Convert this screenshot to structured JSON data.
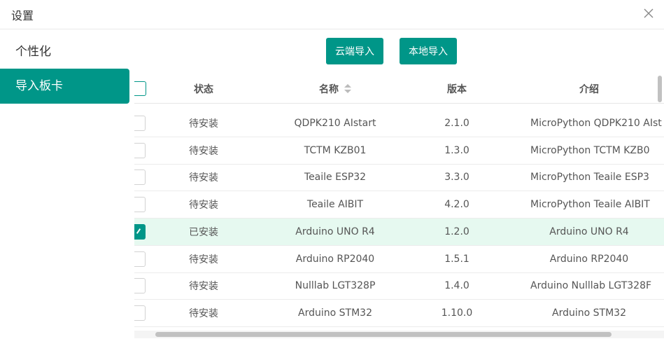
{
  "window": {
    "title": "设置"
  },
  "sidebar": {
    "items": [
      {
        "label": "个性化"
      },
      {
        "label": "导入板卡"
      }
    ]
  },
  "toolbar": {
    "cloud_import": "云端导入",
    "local_import": "本地导入"
  },
  "table": {
    "columns": {
      "status": "状态",
      "name": "名称",
      "version": "版本",
      "intro": "介绍"
    },
    "rows": [
      {
        "checked": false,
        "status": "待安装",
        "name": "QDPK210 AIstart",
        "version": "2.1.0",
        "intro": "MicroPython QDPK210 AIst"
      },
      {
        "checked": false,
        "status": "待安装",
        "name": "TCTM KZB01",
        "version": "1.3.0",
        "intro": "MicroPython TCTM KZB0"
      },
      {
        "checked": false,
        "status": "待安装",
        "name": "Teaile ESP32",
        "version": "3.3.0",
        "intro": "MicroPython Teaile ESP3"
      },
      {
        "checked": false,
        "status": "待安装",
        "name": "Teaile AIBIT",
        "version": "4.2.0",
        "intro": "MicroPython Teaile AIBIT"
      },
      {
        "checked": true,
        "status": "已安装",
        "name": "Arduino UNO R4",
        "version": "1.2.0",
        "intro": "Arduino UNO R4"
      },
      {
        "checked": false,
        "status": "待安装",
        "name": "Arduino RP2040",
        "version": "1.5.1",
        "intro": "Arduino RP2040"
      },
      {
        "checked": false,
        "status": "待安装",
        "name": "Nulllab LGT328P",
        "version": "1.4.0",
        "intro": "Arduino Nulllab LGT328F"
      },
      {
        "checked": false,
        "status": "待安装",
        "name": "Arduino STM32",
        "version": "1.10.0",
        "intro": "Arduino STM32"
      }
    ]
  }
}
